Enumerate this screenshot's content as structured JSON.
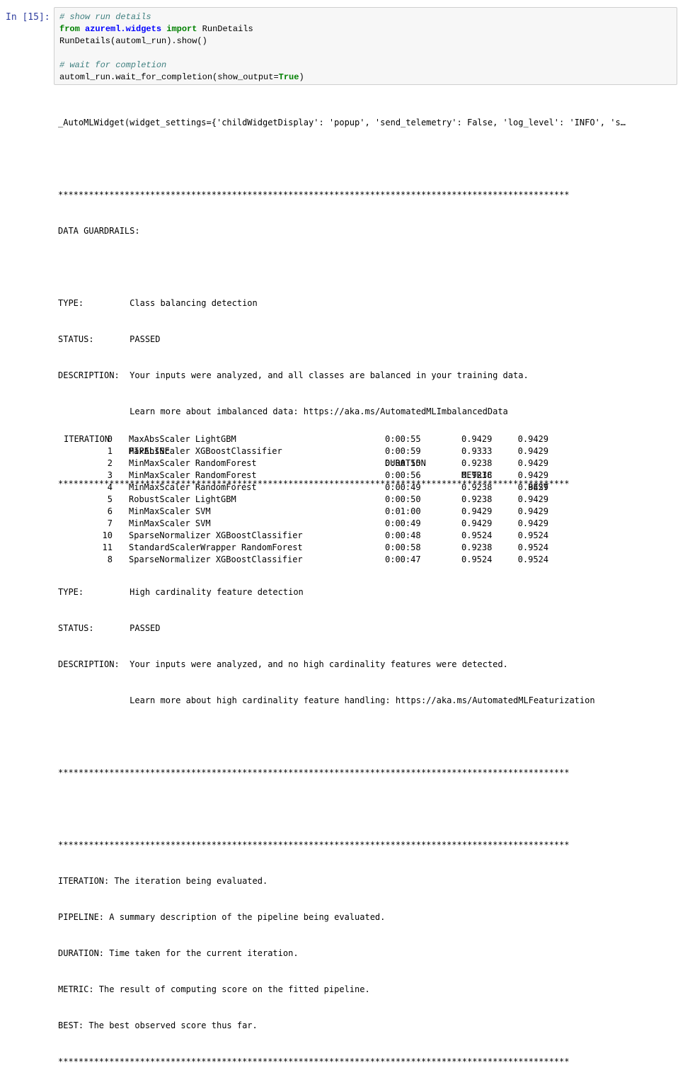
{
  "prompt": "In [15]:",
  "code": {
    "comment1": "# show run details",
    "import_from": "from",
    "module": "azureml.widgets",
    "import_kw": "import",
    "import_name": "RunDetails",
    "line3": "RunDetails(automl_run).show()",
    "comment2": "# wait for completion",
    "line5_pre": "automl_run.wait_for_completion(show_output=",
    "line5_kw": "True",
    "line5_post": ")"
  },
  "output": {
    "widget": "_AutoMLWidget(widget_settings={'childWidgetDisplay': 'popup', 'send_telemetry': False, 'log_level': 'INFO', 's…",
    "stars": "****************************************************************************************************",
    "guardrails_title": "DATA GUARDRAILS:",
    "g1_type": "TYPE:         Class balancing detection",
    "g1_status": "STATUS:       PASSED",
    "g1_desc": "DESCRIPTION:  Your inputs were analyzed, and all classes are balanced in your training data.",
    "g1_learn": "              Learn more about imbalanced data: https://aka.ms/AutomatedMLImbalancedData",
    "g2_type": "TYPE:         High cardinality feature detection",
    "g2_status": "STATUS:       PASSED",
    "g2_desc": "DESCRIPTION:  Your inputs were analyzed, and no high cardinality features were detected.",
    "g2_learn": "              Learn more about high cardinality feature handling: https://aka.ms/AutomatedMLFeaturization",
    "legend_iteration": "ITERATION: The iteration being evaluated.",
    "legend_pipeline": "PIPELINE: A summary description of the pipeline being evaluated.",
    "legend_duration": "DURATION: Time taken for the current iteration.",
    "legend_metric": "METRIC: The result of computing score on the fitted pipeline.",
    "legend_best": "BEST: The best observed score thus far."
  },
  "table": {
    "headers": {
      "iteration": "ITERATION",
      "pipeline": "PIPELINE",
      "duration": "DURATION",
      "metric": "METRIC",
      "best": "BEST"
    },
    "rows": [
      {
        "iteration": "0",
        "pipeline": "MaxAbsScaler LightGBM",
        "duration": "0:00:55",
        "metric": "0.9429",
        "best": "0.9429"
      },
      {
        "iteration": "1",
        "pipeline": "MaxAbsScaler XGBoostClassifier",
        "duration": "0:00:59",
        "metric": "0.9333",
        "best": "0.9429"
      },
      {
        "iteration": "2",
        "pipeline": "MinMaxScaler RandomForest",
        "duration": "0:00:55",
        "metric": "0.9238",
        "best": "0.9429"
      },
      {
        "iteration": "3",
        "pipeline": "MinMaxScaler RandomForest",
        "duration": "0:00:56",
        "metric": "0.9238",
        "best": "0.9429"
      },
      {
        "iteration": "4",
        "pipeline": "MinMaxScaler RandomForest",
        "duration": "0:00:49",
        "metric": "0.9238",
        "best": "0.9429"
      },
      {
        "iteration": "5",
        "pipeline": "RobustScaler LightGBM",
        "duration": "0:00:50",
        "metric": "0.9238",
        "best": "0.9429"
      },
      {
        "iteration": "6",
        "pipeline": "MinMaxScaler SVM",
        "duration": "0:01:00",
        "metric": "0.9429",
        "best": "0.9429"
      },
      {
        "iteration": "7",
        "pipeline": "MinMaxScaler SVM",
        "duration": "0:00:49",
        "metric": "0.9429",
        "best": "0.9429"
      },
      {
        "iteration": "10",
        "pipeline": "SparseNormalizer XGBoostClassifier",
        "duration": "0:00:48",
        "metric": "0.9524",
        "best": "0.9524"
      },
      {
        "iteration": "11",
        "pipeline": "StandardScalerWrapper RandomForest",
        "duration": "0:00:58",
        "metric": "0.9238",
        "best": "0.9524"
      },
      {
        "iteration": "8",
        "pipeline": "SparseNormalizer XGBoostClassifier",
        "duration": "0:00:47",
        "metric": "0.9524",
        "best": "0.9524"
      }
    ]
  }
}
